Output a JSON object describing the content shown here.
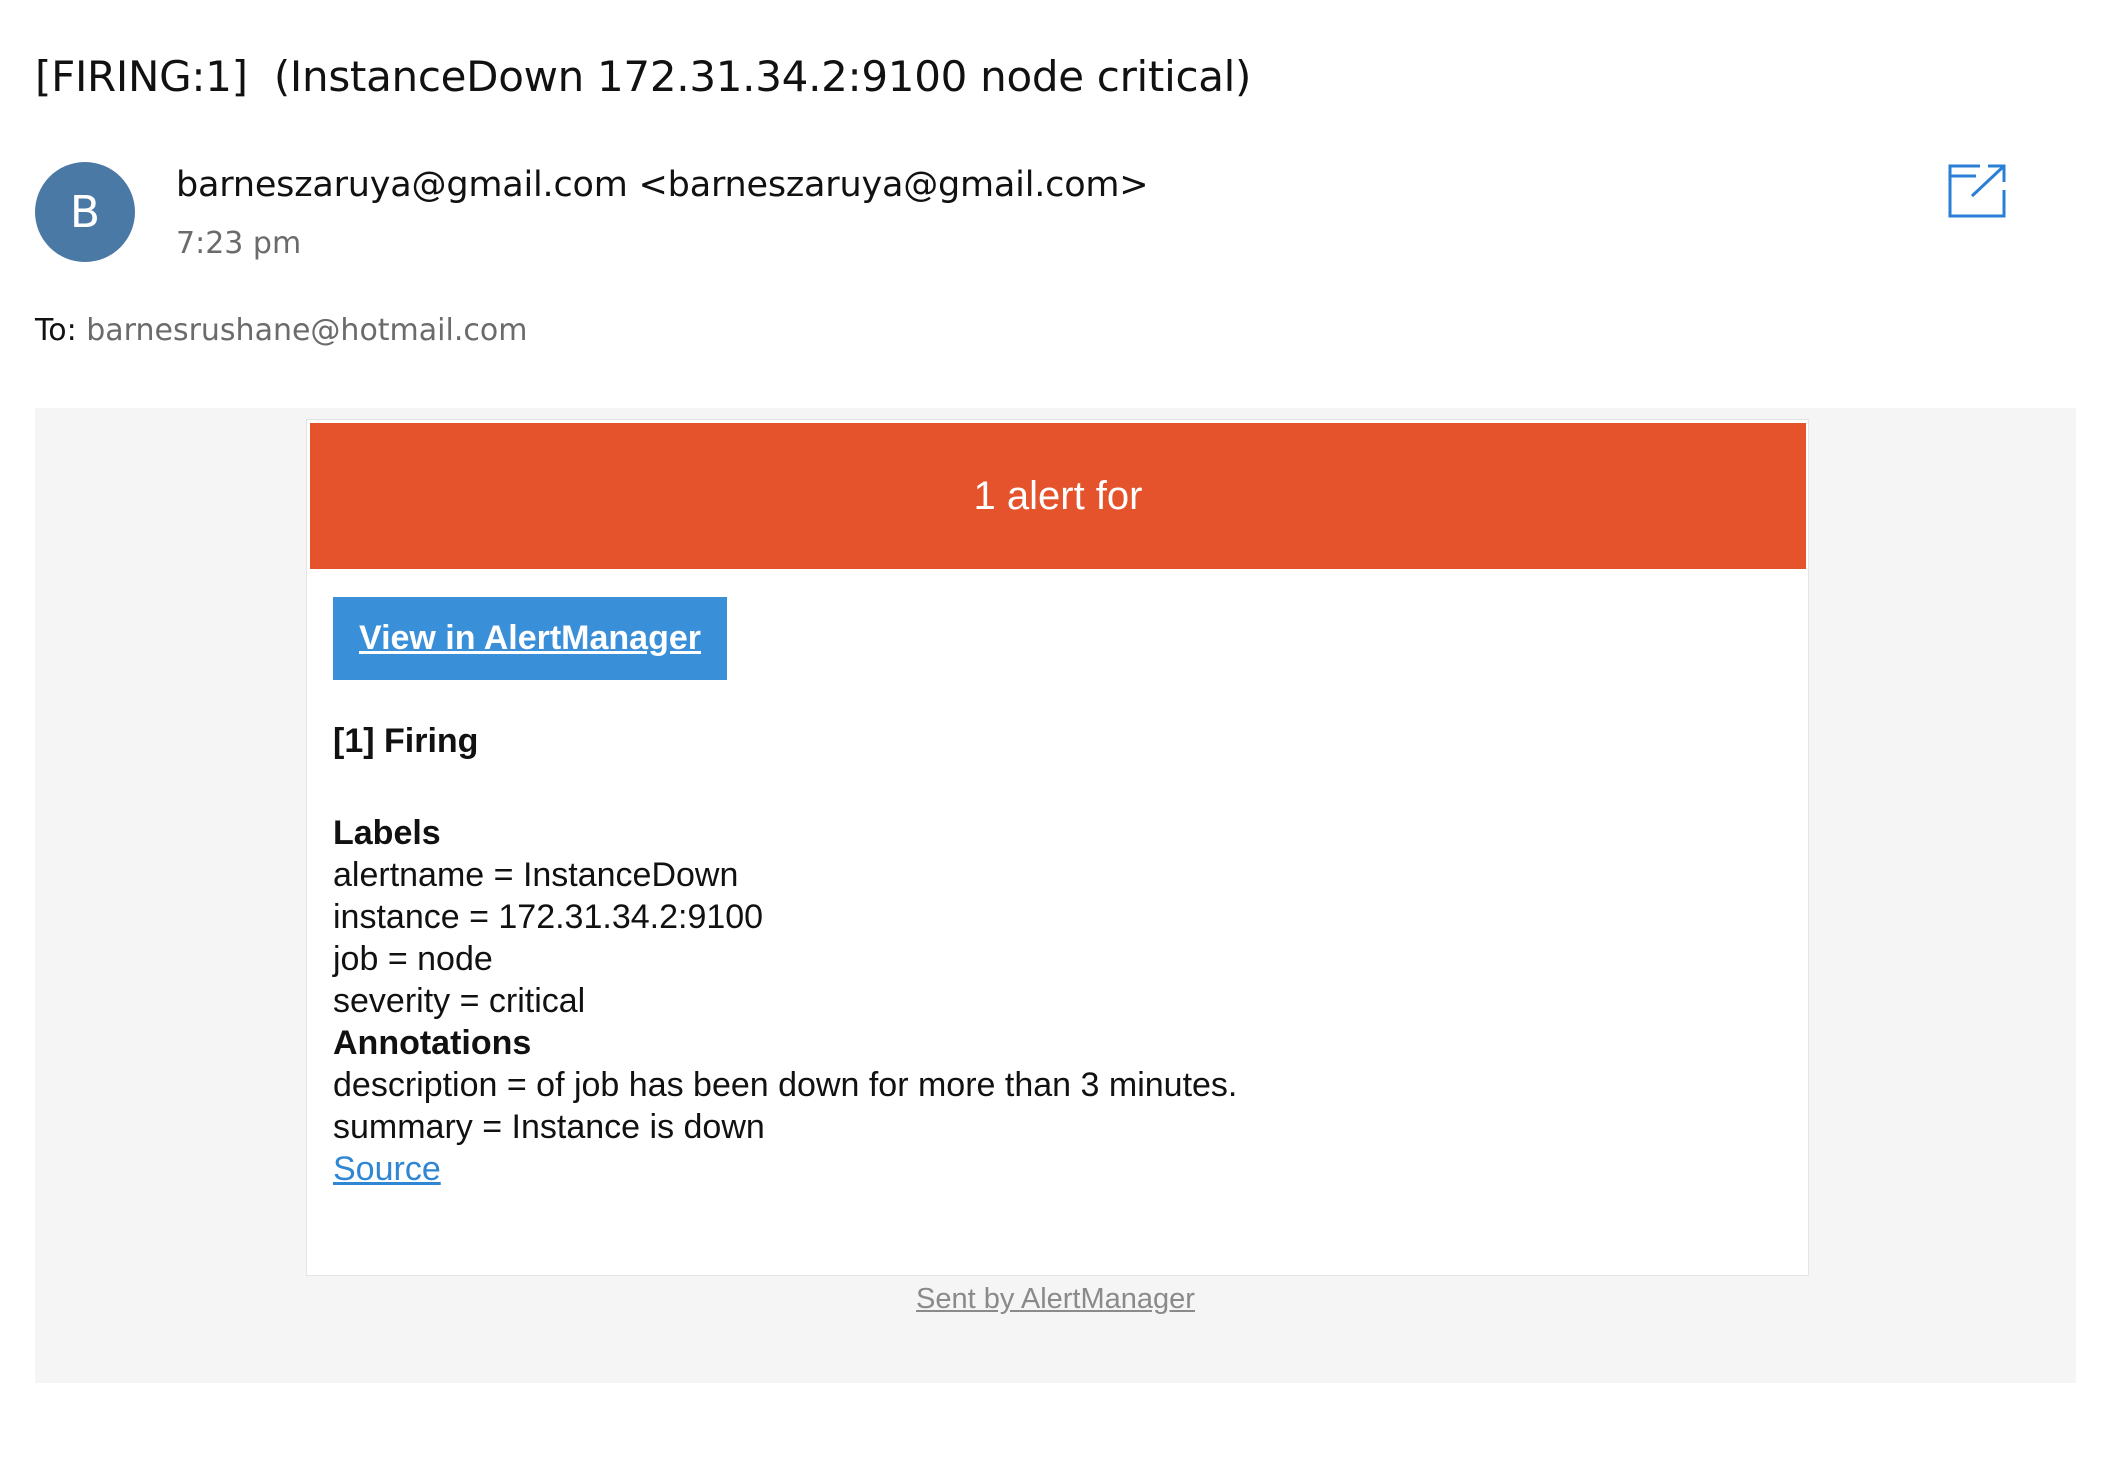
{
  "email": {
    "subject": "[FIRING:1]  (InstanceDown 172.31.34.2:9100 node critical)",
    "avatar_initial": "B",
    "sender": "barneszaruya@gmail.com <barneszaruya@gmail.com>",
    "time": "7:23 pm",
    "to_label": "To:",
    "to_address": "barnesrushane@hotmail.com",
    "popout_icon": "open-in-new-window-icon"
  },
  "alert": {
    "header": "1 alert for",
    "view_button": "View in AlertManager",
    "firing_heading": "[1] Firing",
    "labels_heading": "Labels",
    "labels": [
      "alertname = InstanceDown",
      "instance = 172.31.34.2:9100",
      "job = node",
      "severity = critical"
    ],
    "annotations_heading": "Annotations",
    "annotations": [
      "description = of job has been down for more than 3 minutes.",
      "summary = Instance is down"
    ],
    "source_link": "Source",
    "footer": "Sent by AlertManager"
  },
  "colors": {
    "avatar": "#4a79a6",
    "header_background": "#e5532d",
    "button_background": "#3a8fd9",
    "link": "#2f86d3",
    "popout_icon": "#2a7fd4"
  }
}
